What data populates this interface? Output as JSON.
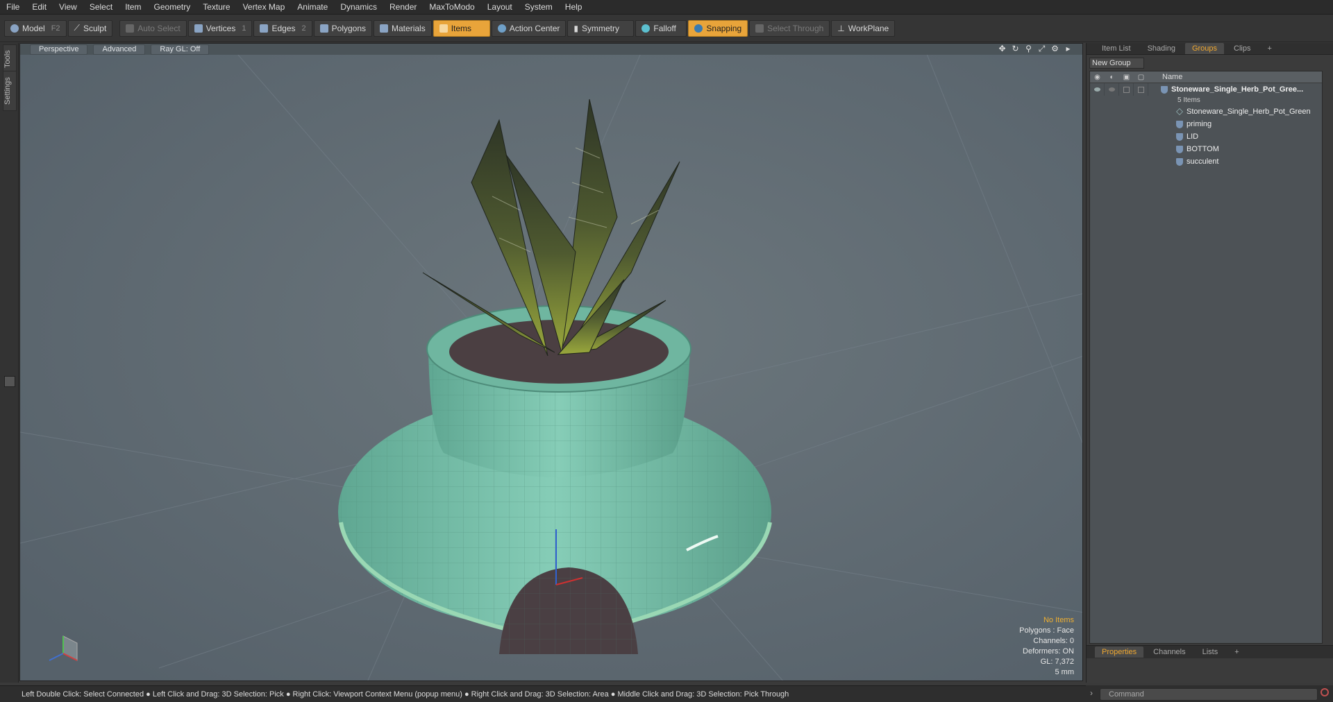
{
  "menu": [
    "File",
    "Edit",
    "View",
    "Select",
    "Item",
    "Geometry",
    "Texture",
    "Vertex Map",
    "Animate",
    "Dynamics",
    "Render",
    "MaxToModo",
    "Layout",
    "System",
    "Help"
  ],
  "toolbar": {
    "model": {
      "label": "Model",
      "key": "F2"
    },
    "sculpt": {
      "label": "Sculpt"
    },
    "auto_select": {
      "label": "Auto Select"
    },
    "vertices": {
      "label": "Vertices",
      "key": "1"
    },
    "edges": {
      "label": "Edges",
      "key": "2"
    },
    "polygons": {
      "label": "Polygons"
    },
    "materials": {
      "label": "Materials"
    },
    "items": {
      "label": "Items"
    },
    "action_center": {
      "label": "Action Center"
    },
    "symmetry": {
      "label": "Symmetry"
    },
    "falloff": {
      "label": "Falloff"
    },
    "snapping": {
      "label": "Snapping"
    },
    "select_through": {
      "label": "Select Through"
    },
    "workplane": {
      "label": "WorkPlane"
    }
  },
  "left_tabs": {
    "tools": "Tools",
    "settings": "Settings"
  },
  "viewport": {
    "perspective": "Perspective",
    "advanced": "Advanced",
    "raygl": "Ray GL: Off",
    "info": {
      "items": "No Items",
      "polygons": "Polygons : Face",
      "channels": "Channels: 0",
      "deformers": "Deformers: ON",
      "gl": "GL: 7,372",
      "unit": "5 mm"
    }
  },
  "right_panel": {
    "tabs": [
      "Item List",
      "Shading",
      "Groups",
      "Clips",
      "+"
    ],
    "active_tab": "Groups",
    "new_group": "New Group",
    "name_header": "Name",
    "root": {
      "name": "Stoneware_Single_Herb_Pot_Gree...",
      "count": "5 Items"
    },
    "children": [
      "Stoneware_Single_Herb_Pot_Green",
      "priming",
      "LID",
      "BOTTOM",
      "succulent"
    ],
    "bottom_tabs": [
      "Properties",
      "Channels",
      "Lists",
      "+"
    ],
    "command_placeholder": "Command"
  },
  "status": "Left Double Click: Select Connected ● Left Click and Drag: 3D Selection: Pick ● Right Click: Viewport Context Menu (popup menu) ● Right Click and Drag: 3D Selection: Area ● Middle Click and Drag: 3D Selection: Pick Through",
  "colors": {
    "accent": "#e8a43a",
    "viewport_bg": "#5f6a70",
    "pot": "#7cc4ae",
    "soil": "#4a3a3a",
    "leaf": "#3c4a2e"
  }
}
